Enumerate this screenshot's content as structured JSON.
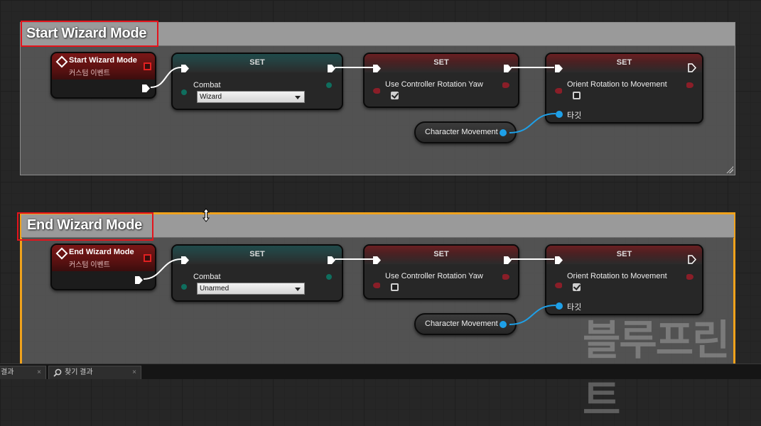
{
  "comments": [
    {
      "title": "Start Wizard Mode",
      "event": {
        "title": "Start Wizard Mode",
        "subtitle": "커스텀 이벤트"
      },
      "set_combat": {
        "header": "SET",
        "label": "Combat",
        "value": "Wizard"
      },
      "set_yaw": {
        "header": "SET",
        "label": "Use Controller Rotation Yaw",
        "checked": true
      },
      "set_orient": {
        "header": "SET",
        "label": "Orient Rotation to Movement",
        "checked": false,
        "target_label": "타깃"
      },
      "movement": {
        "label": "Character Movement"
      }
    },
    {
      "title": "End Wizard Mode",
      "event": {
        "title": "End Wizard Mode",
        "subtitle": "커스텀 이벤트"
      },
      "set_combat": {
        "header": "SET",
        "label": "Combat",
        "value": "Unarmed"
      },
      "set_yaw": {
        "header": "SET",
        "label": "Use Controller Rotation Yaw",
        "checked": false
      },
      "set_orient": {
        "header": "SET",
        "label": "Orient Rotation to Movement",
        "checked": true,
        "target_label": "타깃"
      },
      "movement": {
        "label": "Character Movement"
      }
    }
  ],
  "tabs": [
    {
      "label": "결과",
      "close": "×"
    },
    {
      "label": "찾기 결과",
      "close": "×",
      "icon": "search-icon"
    }
  ],
  "watermark": "블루프린트",
  "colors": {
    "selection_outline": "#f0a21c",
    "highlight_box": "#e4141c",
    "exec_wire": "#ffffff",
    "object_wire": "#1ea0e8"
  }
}
